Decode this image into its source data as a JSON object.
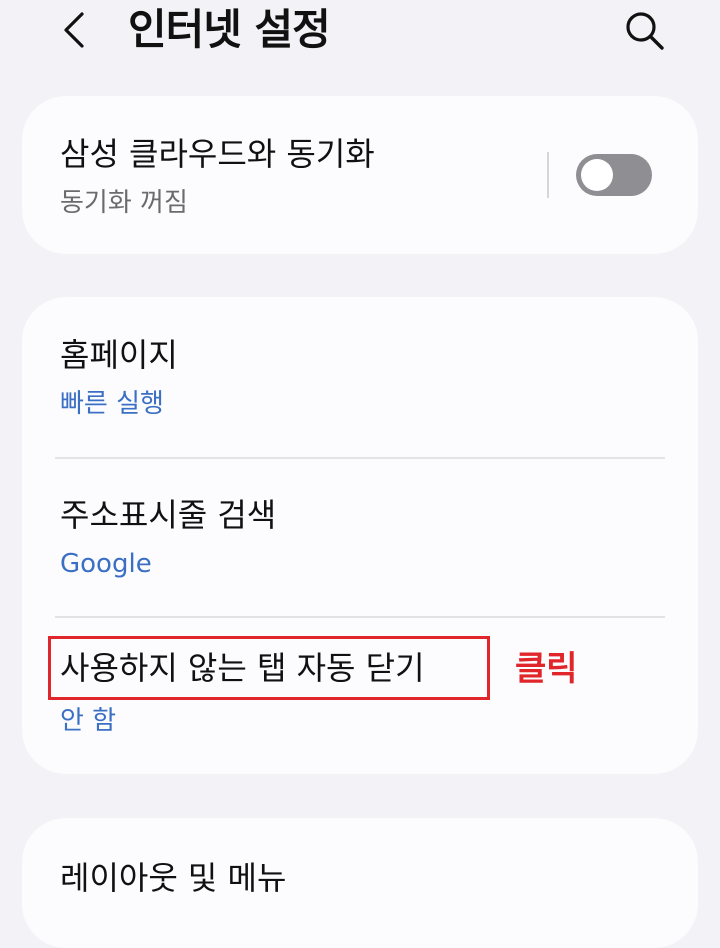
{
  "header": {
    "title": "인터넷 설정",
    "back_icon": "chevron-left-icon",
    "search_icon": "search-icon"
  },
  "sync_card": {
    "title": "삼성 클라우드와 동기화",
    "subtitle": "동기화 꺼짐",
    "toggle_on": false
  },
  "settings": {
    "homepage": {
      "title": "홈페이지",
      "value": "빠른 실행"
    },
    "address_bar_search": {
      "title": "주소표시줄 검색",
      "value": "Google"
    },
    "auto_close_tabs": {
      "title": "사용하지 않는 탭 자동 닫기",
      "value": "안 함"
    }
  },
  "layout_card": {
    "title": "레이아웃 및 메뉴"
  },
  "annotation": {
    "label": "클릭",
    "color": "#e0262b"
  },
  "colors": {
    "background": "#f2f2f7",
    "card": "#fcfcfe",
    "accent_blue": "#3b6fc4",
    "toggle_off": "#8e8e93"
  }
}
